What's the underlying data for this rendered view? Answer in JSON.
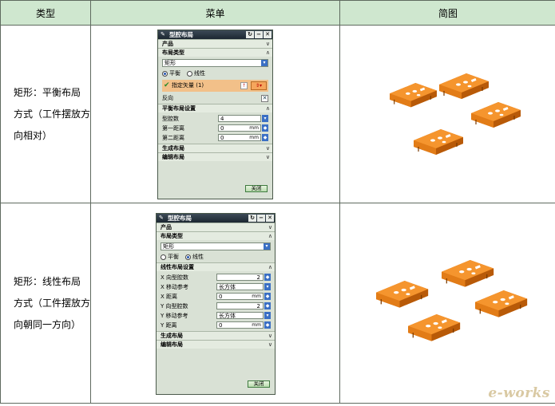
{
  "header": {
    "col_type": "类型",
    "col_menu": "菜单",
    "col_diagram": "简图"
  },
  "rows": [
    {
      "type_lines": [
        "矩形：平衡布局",
        "方式（工件摆放方",
        "向相对）"
      ],
      "dialog": {
        "title": "型腔布局",
        "product_section": "产品",
        "layout_type_section": "布局类型",
        "layout_select": "矩形",
        "radio_balanced": "平衡",
        "radio_linear": "线性",
        "selected_radio": "balanced",
        "vector_label": "指定矢量 (1)",
        "reverse_label": "反向",
        "settings_section": "平衡布局设置",
        "fields": [
          {
            "label": "型腔数",
            "value": "4",
            "unit": "",
            "control": "select"
          },
          {
            "label": "第一距离",
            "value": "0",
            "unit": "mm",
            "control": "spin"
          },
          {
            "label": "第二距离",
            "value": "0",
            "unit": "mm",
            "control": "spin"
          }
        ],
        "generate_section": "生成布局",
        "edit_section": "编辑布局",
        "close_label": "关闭"
      }
    },
    {
      "type_lines": [
        "矩形：线性布局",
        "方式（工件摆放方",
        "向朝同一方向）"
      ],
      "dialog": {
        "title": "型腔布局",
        "product_section": "产品",
        "layout_type_section": "布局类型",
        "layout_select": "矩形",
        "radio_balanced": "平衡",
        "radio_linear": "线性",
        "selected_radio": "linear",
        "settings_section": "线性布局设置",
        "fields": [
          {
            "label": "X 向型腔数",
            "value": "2",
            "unit": "",
            "control": "spin"
          },
          {
            "label": "X 移动参考",
            "value": "长方体",
            "unit": "",
            "control": "select"
          },
          {
            "label": "X 距离",
            "value": "0",
            "unit": "mm",
            "control": "spin"
          },
          {
            "label": "Y 向型腔数",
            "value": "2",
            "unit": "",
            "control": "spin"
          },
          {
            "label": "Y 移动参考",
            "value": "长方体",
            "unit": "",
            "control": "select"
          },
          {
            "label": "Y 距离",
            "value": "0",
            "unit": "mm",
            "control": "spin"
          }
        ],
        "generate_section": "生成布局",
        "edit_section": "编辑布局",
        "close_label": "关闭"
      }
    }
  ],
  "watermark": "e-works",
  "colors": {
    "header_bg": "#cfe7cf",
    "part_orange": "#f08a1c",
    "dialog_bg": "#d9e1d5"
  }
}
